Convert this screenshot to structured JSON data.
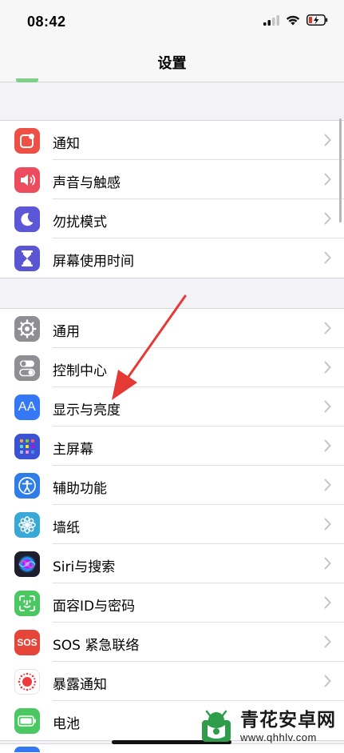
{
  "status_bar": {
    "time": "08:42"
  },
  "nav": {
    "title": "设置"
  },
  "groups": [
    {
      "items": [
        {
          "label": "通知",
          "icon": "notifications-icon",
          "color": "#ef5046"
        },
        {
          "label": "声音与触感",
          "icon": "speaker-icon",
          "color": "#ec4c5e"
        },
        {
          "label": "勿扰模式",
          "icon": "moon-icon",
          "color": "#5c57d6"
        },
        {
          "label": "屏幕使用时间",
          "icon": "hourglass-icon",
          "color": "#5a55d2"
        }
      ]
    },
    {
      "items": [
        {
          "label": "通用",
          "icon": "gear-icon",
          "color": "#8e8e93"
        },
        {
          "label": "控制中心",
          "icon": "toggles-icon",
          "color": "#8e8e93"
        },
        {
          "label": "显示与亮度",
          "icon": "text-size-icon",
          "color": "#3478f6"
        },
        {
          "label": "主屏幕",
          "icon": "home-grid-icon",
          "color": "#3c52d6"
        },
        {
          "label": "辅助功能",
          "icon": "accessibility-icon",
          "color": "#2f7de9"
        },
        {
          "label": "墙纸",
          "icon": "flower-icon",
          "color": "#38a9d6"
        },
        {
          "label": "Siri与搜索",
          "icon": "siri-icon",
          "color": "#1e1e2e"
        },
        {
          "label": "面容ID与密码",
          "icon": "face-id-icon",
          "color": "#4cc862"
        },
        {
          "label": "SOS 紧急联络",
          "icon": "sos-icon",
          "color": "#e6463a"
        },
        {
          "label": "暴露通知",
          "icon": "exposure-icon",
          "color": "#ffffff"
        },
        {
          "label": "电池",
          "icon": "battery-icon",
          "color": "#4cc862"
        }
      ]
    }
  ],
  "sos_text": "SOS",
  "text_size_glyph": "AA",
  "watermark": {
    "name": "青花安卓网",
    "url": "www.qhhlv.com"
  }
}
